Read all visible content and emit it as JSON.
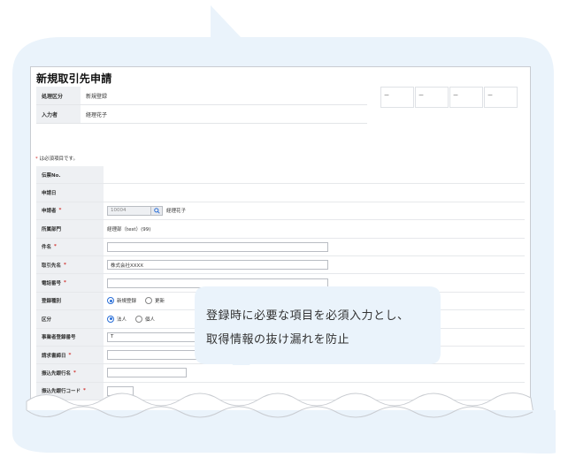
{
  "form_title": "新規取引先申請",
  "header_info": [
    {
      "label": "処理区分",
      "value": "新規登録"
    },
    {
      "label": "入力者",
      "value": "経理花子"
    }
  ],
  "approval_cells": [
    "ー",
    "ー",
    "ー",
    "ー"
  ],
  "required_note": {
    "mark": "*",
    "text": " は必須項目です。"
  },
  "fields": {
    "slip_no": {
      "label": "伝票No."
    },
    "apply_date": {
      "label": "申請日"
    },
    "applicant": {
      "label": "申請者",
      "code": "10004",
      "name": "経理花子"
    },
    "department": {
      "label": "所属部門",
      "value": "経理部（test）(99)"
    },
    "subject": {
      "label": "件名"
    },
    "partner_name": {
      "label": "取引先名",
      "value": "株式会社XXXX"
    },
    "phone": {
      "label": "電話番号"
    },
    "reg_type": {
      "label": "登録種別",
      "options": [
        "新規登録",
        "更新"
      ],
      "selected": "新規登録"
    },
    "category": {
      "label": "区分",
      "options": [
        "法人",
        "個人"
      ],
      "selected": "法人"
    },
    "invoice_no": {
      "label": "事業者登録番号",
      "value": "T"
    },
    "billing_close": {
      "label": "請求書締日"
    },
    "bank_name": {
      "label": "振込先銀行名"
    },
    "bank_code": {
      "label": "振込先銀行コード"
    }
  },
  "required_mark": "*",
  "callout": {
    "line1": "登録時に必要な項目を必須入力とし、",
    "line2": "取得情報の抜け漏れを防止"
  },
  "colors": {
    "bubble_bg": "#eaf3fb",
    "accent": "#2a6fd8",
    "required": "#d0312d"
  }
}
